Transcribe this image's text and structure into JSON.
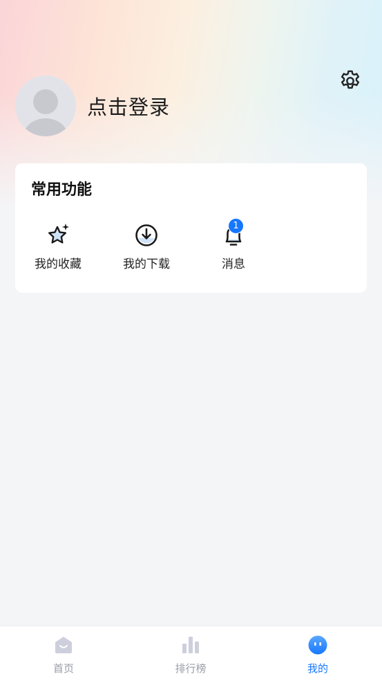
{
  "header": {
    "login_text": "点击登录",
    "settings_icon": "gear-icon",
    "avatar_icon": "user-avatar-icon"
  },
  "functions": {
    "title": "常用功能",
    "items": [
      {
        "label": "我的收藏",
        "icon": "star-sparkle-icon"
      },
      {
        "label": "我的下载",
        "icon": "download-icon"
      },
      {
        "label": "消息",
        "icon": "bell-icon",
        "badge": "1"
      }
    ]
  },
  "tabbar": {
    "items": [
      {
        "label": "首页",
        "icon": "home-icon",
        "active": false
      },
      {
        "label": "排行榜",
        "icon": "ranking-bars-icon",
        "active": false
      },
      {
        "label": "我的",
        "icon": "profile-face-icon",
        "active": true
      }
    ]
  },
  "colors": {
    "accent": "#1677ff",
    "tab_inactive": "#9a9ca6",
    "page_bg": "#f4f5f7",
    "card_bg": "#ffffff"
  }
}
